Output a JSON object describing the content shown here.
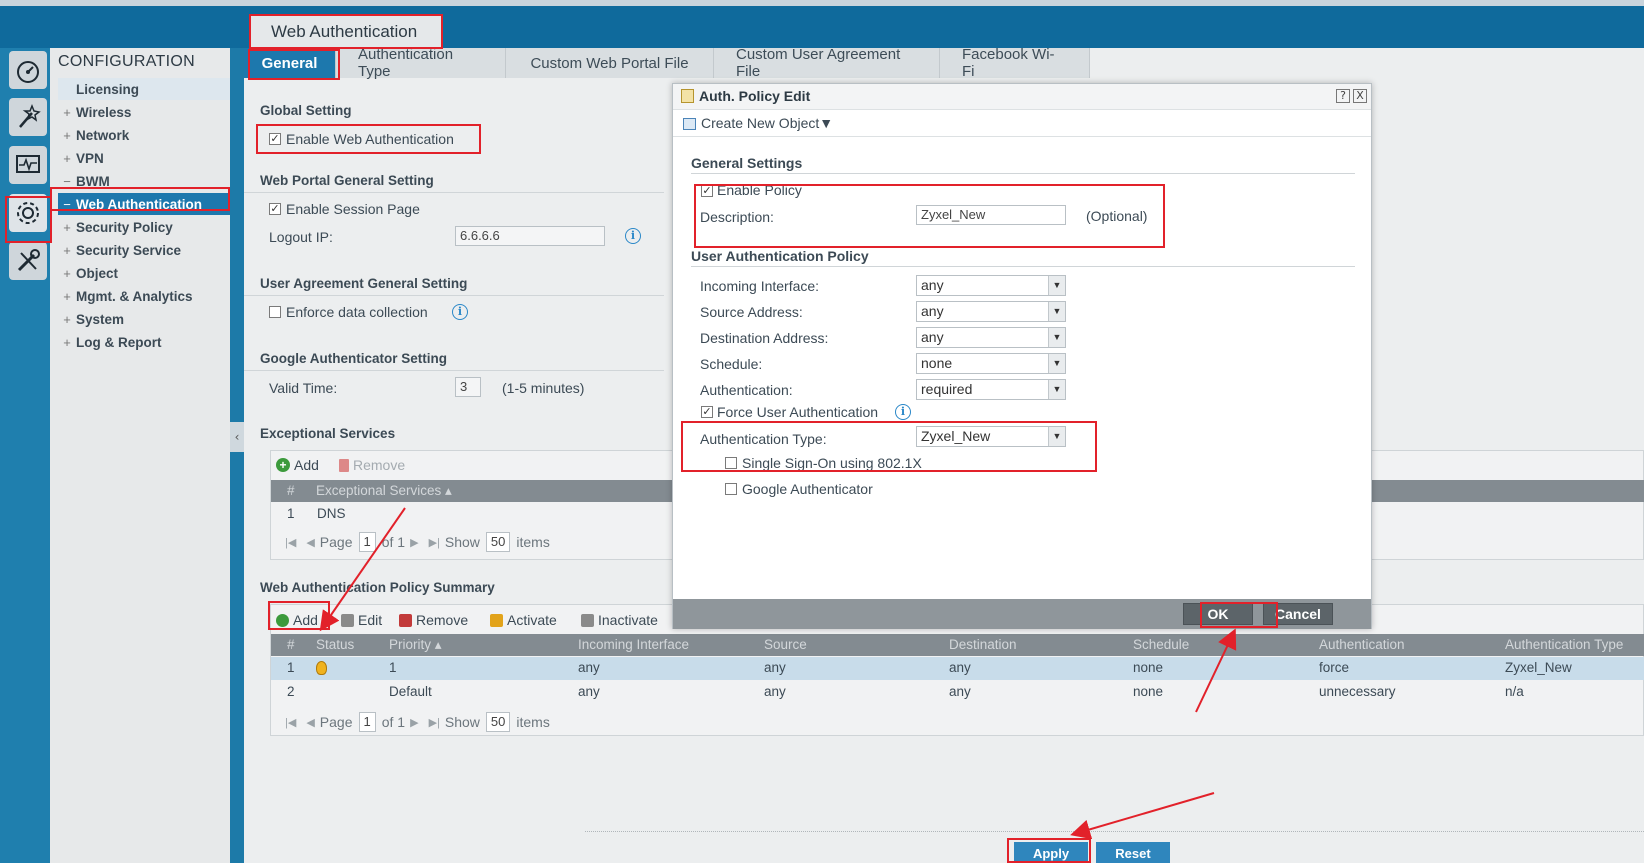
{
  "page_title": "Web Authentication",
  "tabs": [
    {
      "label": "General"
    },
    {
      "label": "Authentication Type"
    },
    {
      "label": "Custom Web Portal File"
    },
    {
      "label": "Custom User Agreement File"
    },
    {
      "label": "Facebook Wi-Fi"
    }
  ],
  "nav": {
    "title": "CONFIGURATION",
    "items": [
      {
        "label": "Licensing",
        "prefix": ""
      },
      {
        "label": "Wireless",
        "prefix": "+"
      },
      {
        "label": "Network",
        "prefix": "+"
      },
      {
        "label": "VPN",
        "prefix": "+"
      },
      {
        "label": "BWM",
        "prefix": "−"
      },
      {
        "label": "Web Authentication",
        "prefix": "−"
      },
      {
        "label": "Security Policy",
        "prefix": "+"
      },
      {
        "label": "Security Service",
        "prefix": "+"
      },
      {
        "label": "Object",
        "prefix": "+"
      },
      {
        "label": "Mgmt. & Analytics",
        "prefix": "+"
      },
      {
        "label": "System",
        "prefix": "+"
      },
      {
        "label": "Log & Report",
        "prefix": "+"
      }
    ]
  },
  "strip_icons": [
    "dashboard-icon",
    "wand-icon",
    "monitor-icon",
    "gear-icon",
    "tools-icon"
  ],
  "global_setting": {
    "title": "Global Setting",
    "enable_web_auth": "Enable Web Authentication",
    "enable_web_auth_checked": true
  },
  "web_portal": {
    "title": "Web Portal General Setting",
    "enable_session_page": "Enable Session Page",
    "enable_session_page_checked": true,
    "logout_ip_label": "Logout IP:",
    "logout_ip_value": "6.6.6.6"
  },
  "user_agreement": {
    "title": "User Agreement General Setting",
    "enforce_label": "Enforce data collection",
    "enforce_checked": false
  },
  "google_auth": {
    "title": "Google Authenticator Setting",
    "valid_time_label": "Valid Time:",
    "valid_time_value": "3",
    "valid_time_hint": "(1-5 minutes)"
  },
  "exceptional": {
    "title": "Exceptional Services",
    "add": "Add",
    "remove": "Remove",
    "columns": [
      "#",
      "Exceptional Services ▴"
    ],
    "rows": [
      [
        "1",
        "DNS"
      ]
    ],
    "pager": {
      "page": "Page",
      "page_value": "1",
      "of": "of 1",
      "show": "Show",
      "show_value": "50",
      "items": "items"
    }
  },
  "policy_summary": {
    "title": "Web Authentication Policy Summary",
    "toolbar": {
      "add": "Add",
      "edit": "Edit",
      "remove": "Remove",
      "activate": "Activate",
      "inactivate": "Inactivate"
    },
    "columns": [
      "#",
      "Status",
      "Priority ▴",
      "Incoming Interface",
      "Source",
      "Destination",
      "Schedule",
      "Authentication",
      "Authentication Type"
    ],
    "rows": [
      [
        "1",
        "",
        "1",
        "any",
        "any",
        "any",
        "none",
        "force",
        "Zyxel_New"
      ],
      [
        "2",
        "",
        "Default",
        "any",
        "any",
        "any",
        "none",
        "unnecessary",
        "n/a"
      ]
    ],
    "pager": {
      "page": "Page",
      "page_value": "1",
      "of": "of 1",
      "show": "Show",
      "show_value": "50",
      "items": "items"
    }
  },
  "buttons": {
    "apply": "Apply",
    "reset": "Reset"
  },
  "dialog": {
    "title": "Auth. Policy Edit",
    "help": "?",
    "close": "X",
    "create_new_object": "Create New Object▼",
    "general_settings": "General Settings",
    "enable_policy": "Enable Policy",
    "enable_policy_checked": true,
    "description_label": "Description:",
    "description_value": "Zyxel_New",
    "optional": "(Optional)",
    "user_auth_policy": "User Authentication Policy",
    "fields": [
      {
        "label": "Incoming Interface:",
        "value": "any"
      },
      {
        "label": "Source Address:",
        "value": "any"
      },
      {
        "label": "Destination Address:",
        "value": "any"
      },
      {
        "label": "Schedule:",
        "value": "none"
      },
      {
        "label": "Authentication:",
        "value": "required"
      }
    ],
    "force_user_auth": "Force User Authentication",
    "force_user_auth_checked": true,
    "auth_type_label": "Authentication Type:",
    "auth_type_value": "Zyxel_New",
    "sso": "Single Sign-On using 802.1X",
    "sso_checked": false,
    "google_authenticator": "Google Authenticator",
    "google_checked": false,
    "ok": "OK",
    "cancel": "Cancel"
  },
  "colors": {
    "accent": "#1d78ad",
    "annotation_red": "#e2212a",
    "sidebar_bg": "#1f7fae"
  }
}
